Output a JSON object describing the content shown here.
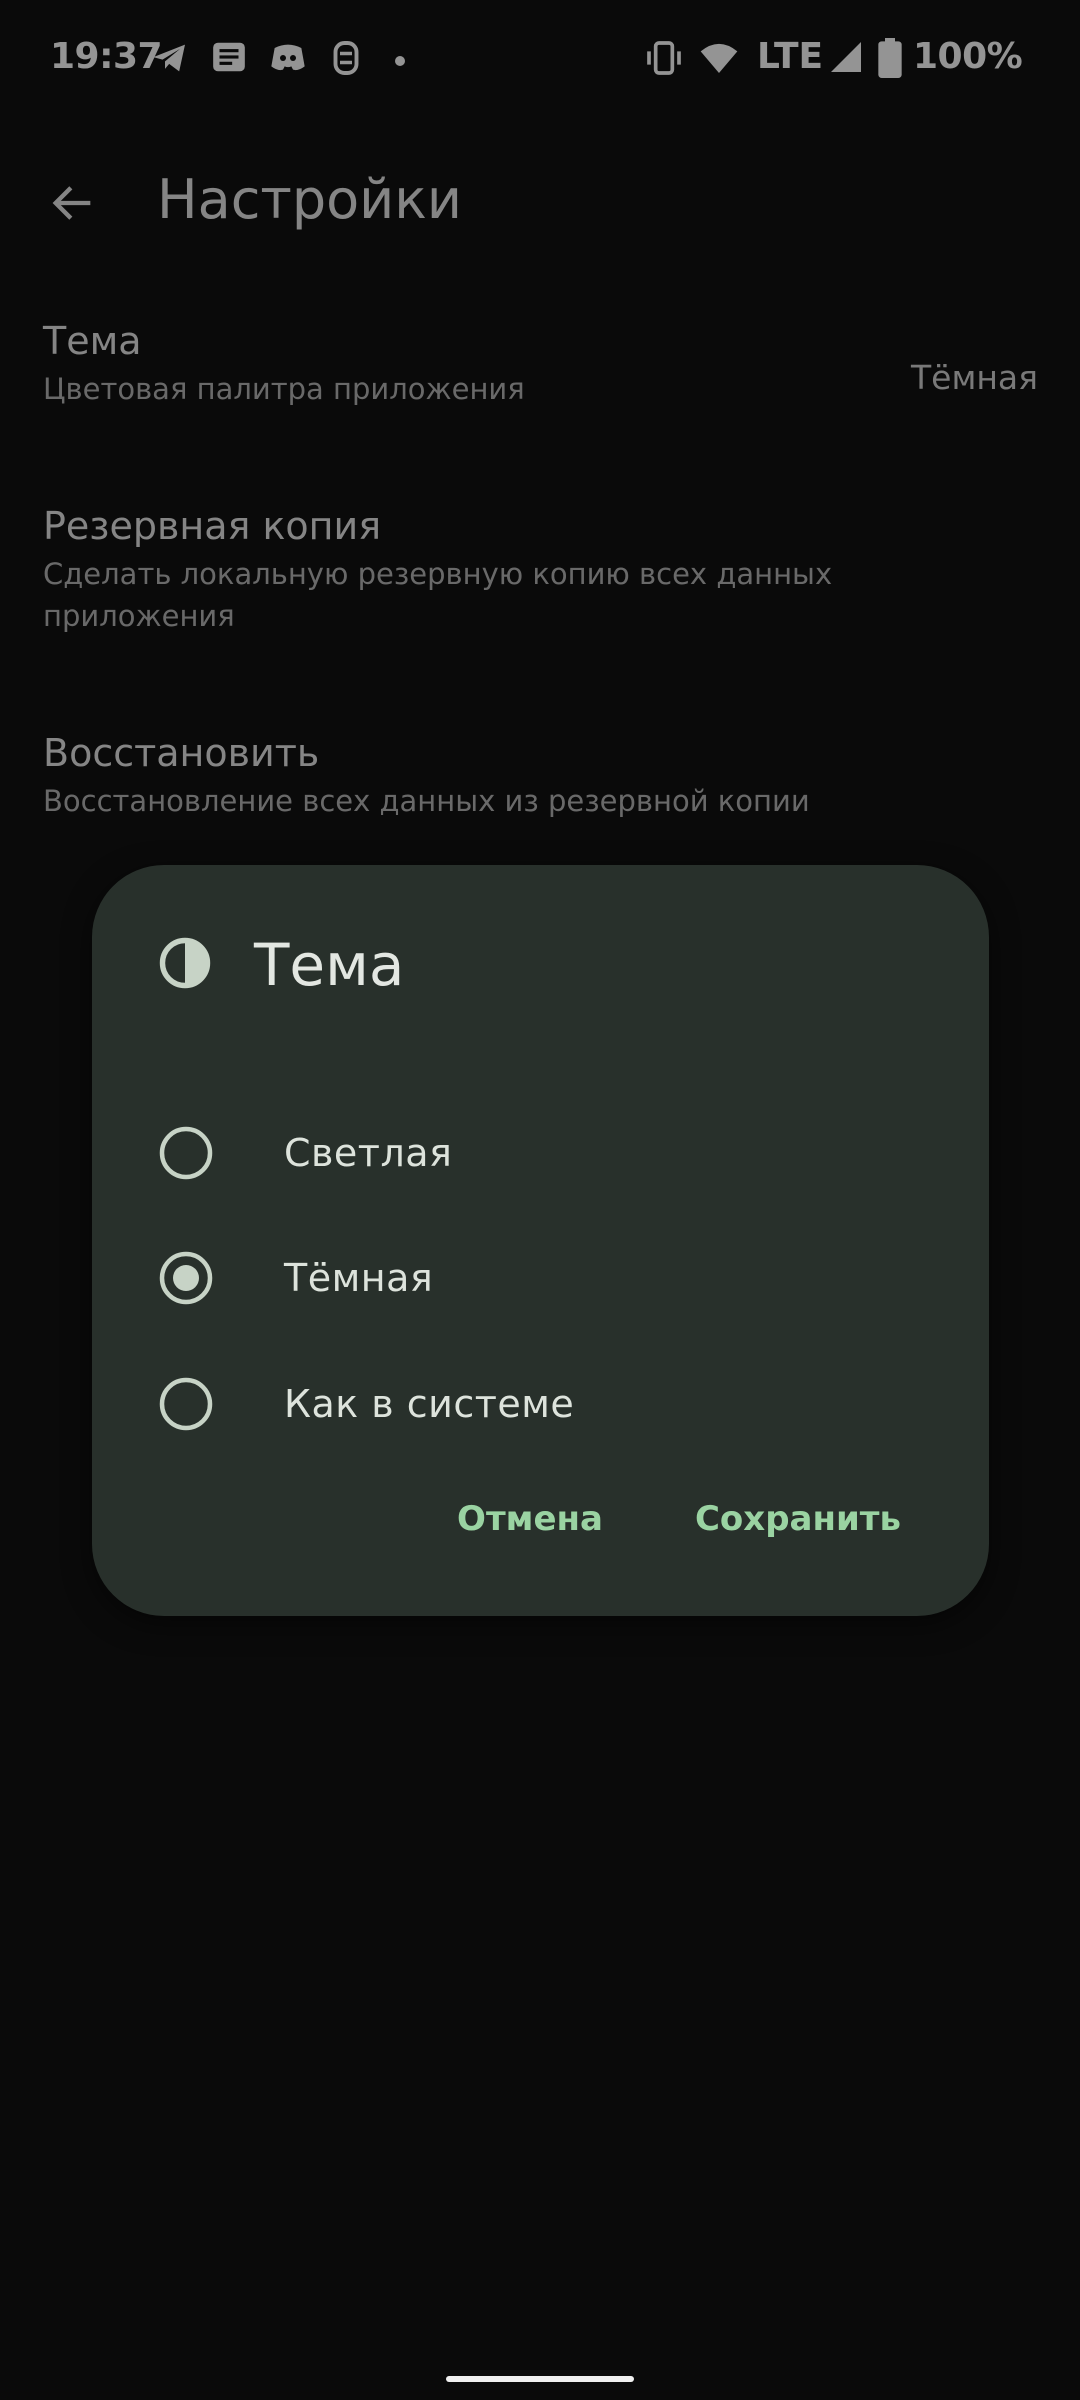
{
  "status_bar": {
    "time": "19:37",
    "network": "LTE",
    "battery": "100%",
    "icons": [
      "telegram-icon",
      "news-icon",
      "discord-icon",
      "fasting-app-icon",
      "notification-dot-icon",
      "vibrate-icon",
      "wifi-icon",
      "signal-icon",
      "battery-icon"
    ]
  },
  "app_bar": {
    "title": "Настройки"
  },
  "settings": {
    "items": [
      {
        "title": "Тема",
        "subtitle": "Цветовая палитра приложения",
        "value": "Тёмная"
      },
      {
        "title": "Резервная копия",
        "subtitle": "Сделать локальную резервную копию всех данных приложения"
      },
      {
        "title": "Восстановить",
        "subtitle": "Восстановление всех данных из резервной копии"
      }
    ]
  },
  "dialog": {
    "icon": "contrast-icon",
    "title": "Тема",
    "options": [
      {
        "label": "Светлая",
        "selected": false
      },
      {
        "label": "Тёмная",
        "selected": true
      },
      {
        "label": "Как в системе",
        "selected": false
      }
    ],
    "cancel_label": "Отмена",
    "confirm_label": "Сохранить"
  },
  "colors": {
    "background": "#121212",
    "dialog_surface": "#28302b",
    "accent": "#9ad3a2",
    "radio": "#c7d3c6"
  }
}
